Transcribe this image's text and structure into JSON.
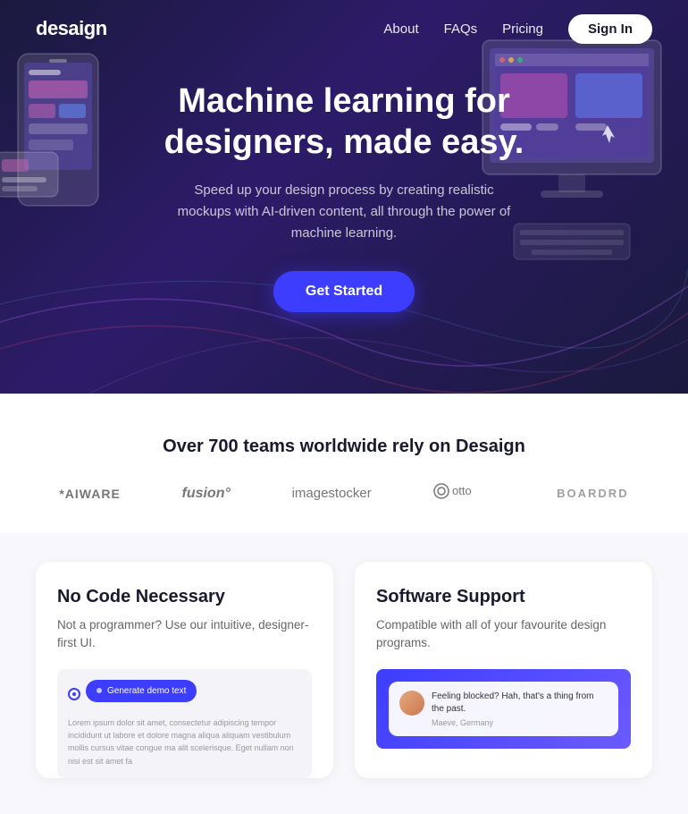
{
  "nav": {
    "logo": "desaign",
    "links": [
      {
        "label": "About",
        "name": "about-link"
      },
      {
        "label": "FAQs",
        "name": "faqs-link"
      },
      {
        "label": "Pricing",
        "name": "pricing-link"
      }
    ],
    "signin_label": "Sign In"
  },
  "hero": {
    "title": "Machine learning for designers, made easy.",
    "subtitle": "Speed up your design process by creating realistic mockups with AI-driven content, all through the power of machine learning.",
    "cta_label": "Get Started"
  },
  "social_proof": {
    "title": "Over 700 teams worldwide rely on Desaign",
    "logos": [
      {
        "text": "*AIWARE",
        "class": "aiware"
      },
      {
        "text": "fusion°",
        "class": "fusion"
      },
      {
        "text": "imagestocker",
        "class": "imagestocker"
      },
      {
        "text": "⊛otto",
        "class": "otto"
      },
      {
        "text": "BOARDRD",
        "class": "boardrd"
      }
    ]
  },
  "features": [
    {
      "id": "no-code",
      "title": "No Code Necessary",
      "desc": "Not a programmer? Use our intuitive, designer-first UI.",
      "preview_text": "Lorem ipsum dolor sit amet, consectetur adipiscing tempor incididunt ut labore et dolore magna aliqua aliquam vestibulum mollis cursus vitae congue ma alit scelerisque. Eget nullam non nisi est sit amet fa",
      "generate_label": "Generate demo text"
    },
    {
      "id": "software-support",
      "title": "Software Support",
      "desc": "Compatible with all of your favourite design programs.",
      "chat_text": "Feeling blocked? Hah, that's a thing from the past.",
      "chat_author": "Maeve, Germany"
    }
  ]
}
